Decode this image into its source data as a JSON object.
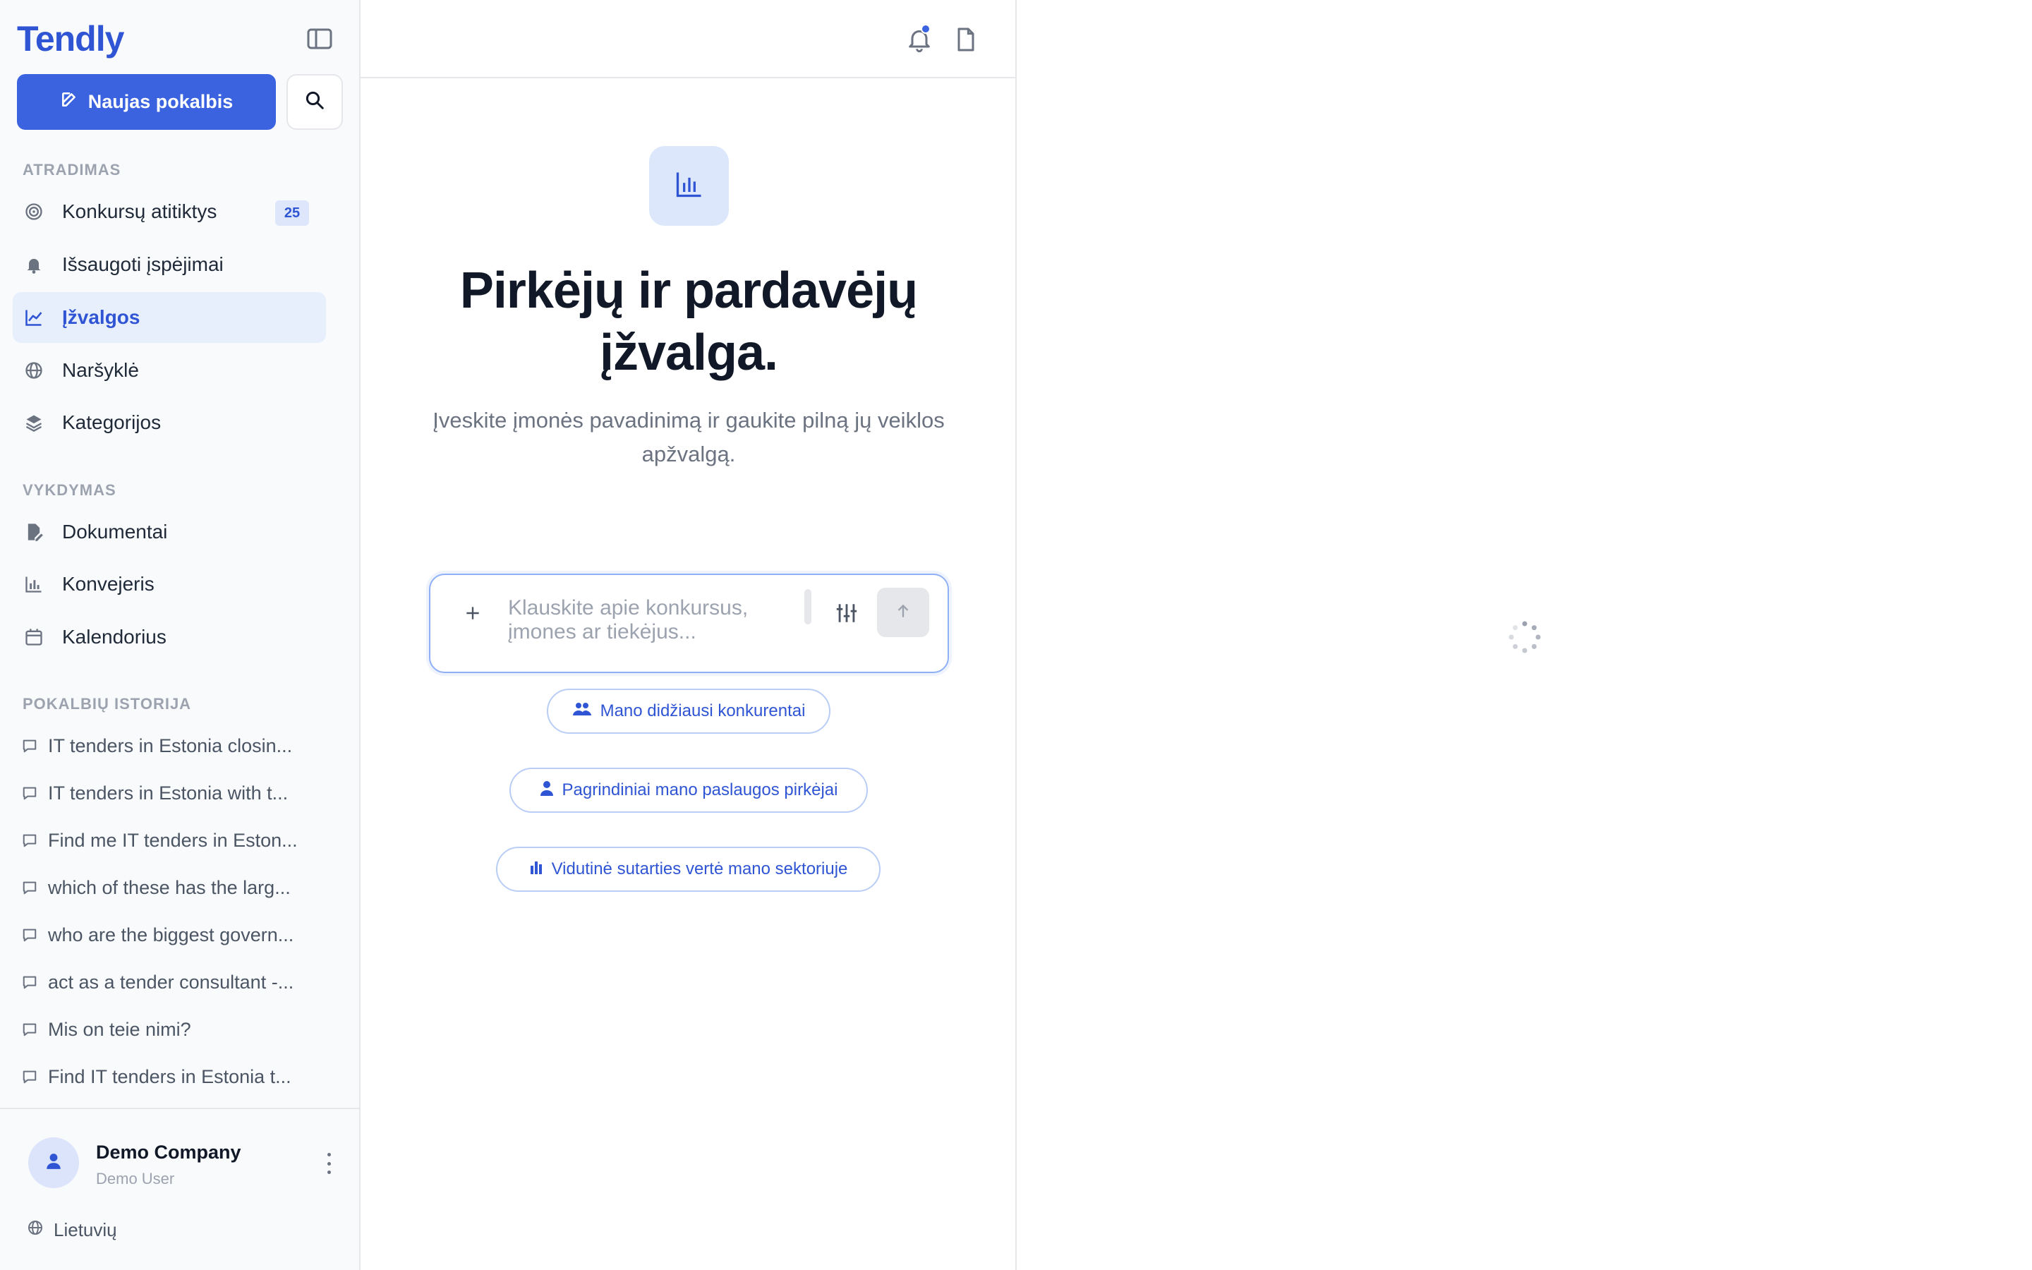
{
  "app": {
    "logo": "Tendly"
  },
  "sidebar": {
    "new_chat_label": "Naujas pokalbis",
    "sections": {
      "discovery": "ATRADIMAS",
      "execution": "VYKDYMAS",
      "history": "POKALBIŲ ISTORIJA"
    },
    "discovery_items": [
      {
        "label": "Konkursų atitiktys",
        "icon": "target-icon",
        "badge": "25"
      },
      {
        "label": "Išsaugoti įspėjimai",
        "icon": "bell-icon"
      },
      {
        "label": "Įžvalgos",
        "icon": "trend-chart-icon",
        "active": true
      },
      {
        "label": "Naršyklė",
        "icon": "globe-icon"
      },
      {
        "label": "Kategorijos",
        "icon": "layers-icon"
      }
    ],
    "execution_items": [
      {
        "label": "Dokumentai",
        "icon": "document-edit-icon"
      },
      {
        "label": "Konvejeris",
        "icon": "bar-chart-icon"
      },
      {
        "label": "Kalendorius",
        "icon": "calendar-icon"
      }
    ],
    "history_items": [
      "IT tenders in Estonia closin...",
      "IT tenders in Estonia with t...",
      "Find me IT tenders in Eston...",
      "which of these has the larg...",
      "who are the biggest govern...",
      "act as a tender consultant -...",
      "Mis on teie nimi?",
      "Find IT tenders in Estonia t..."
    ],
    "user": {
      "name": "Demo Company",
      "role": "Demo User"
    },
    "language": "Lietuvių"
  },
  "main": {
    "hero_title": "Pirkėjų ir pardavėjų įžvalga.",
    "hero_subtitle": "Įveskite įmonės pavadinimą ir gaukite pilną jų veiklos apžvalgą.",
    "input_placeholder": "Klauskite apie konkursus, įmones ar tiekėjus...",
    "suggestions": [
      {
        "label": "Mano didžiausi konkurentai",
        "icon": "users-icon"
      },
      {
        "label": "Pagrindiniai mano paslaugos pirkėjai",
        "icon": "user-icon"
      },
      {
        "label": "Vidutinė sutarties vertė mano sektoriuje",
        "icon": "bar-chart-icon"
      }
    ]
  },
  "colors": {
    "accent": "#3b63e0",
    "active_bg": "#e8effc",
    "text": "#111827",
    "muted": "#6b7280"
  }
}
